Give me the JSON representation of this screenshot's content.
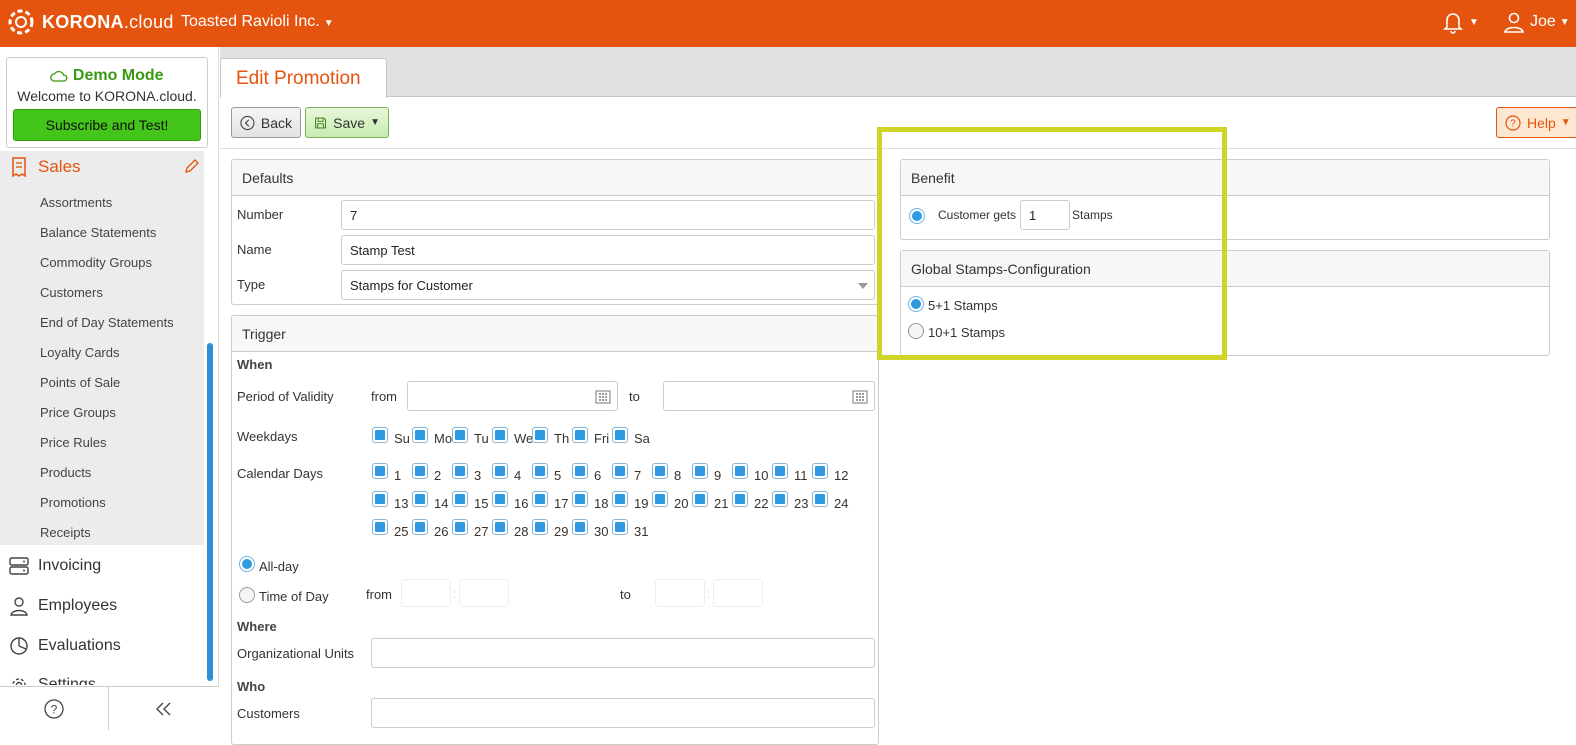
{
  "topbar": {
    "logo_text": "KORONA",
    "logo_suffix": ".cloud",
    "company": "Toasted Ravioli Inc.",
    "user": "Joe"
  },
  "sidebar": {
    "demo_title": "Demo Mode",
    "demo_welcome": "Welcome to KORONA.cloud.",
    "subscribe_label": "Subscribe and Test!",
    "sales_label": "Sales",
    "sales_items": [
      "Assortments",
      "Balance Statements",
      "Commodity Groups",
      "Customers",
      "End of Day Statements",
      "Loyalty Cards",
      "Points of Sale",
      "Price Groups",
      "Price Rules",
      "Products",
      "Promotions",
      "Receipts"
    ],
    "main_items": [
      "Invoicing",
      "Employees",
      "Evaluations",
      "Settings"
    ]
  },
  "tab": {
    "label": "Edit Promotion"
  },
  "toolbar": {
    "back_label": "Back",
    "save_label": "Save",
    "help_label": "Help"
  },
  "defaults": {
    "title": "Defaults",
    "number_label": "Number",
    "number_value": "7",
    "name_label": "Name",
    "name_value": "Stamp Test",
    "type_label": "Type",
    "type_value": "Stamps for Customer"
  },
  "trigger": {
    "title": "Trigger",
    "when_label": "When",
    "period_label": "Period of Validity",
    "from_label": "from",
    "to_label": "to",
    "weekdays_label": "Weekdays",
    "weekdays": [
      "Su",
      "Mo",
      "Tu",
      "We",
      "Th",
      "Fri",
      "Sa"
    ],
    "calendar_label": "Calendar Days",
    "days": [
      "1",
      "2",
      "3",
      "4",
      "5",
      "6",
      "7",
      "8",
      "9",
      "10",
      "11",
      "12",
      "13",
      "14",
      "15",
      "16",
      "17",
      "18",
      "19",
      "20",
      "21",
      "22",
      "23",
      "24",
      "25",
      "26",
      "27",
      "28",
      "29",
      "30",
      "31"
    ],
    "allday_label": "All-day",
    "timeofday_label": "Time of Day",
    "time_from_label": "from",
    "time_to_label": "to",
    "time_separator": ":",
    "where_label": "Where",
    "org_units_label": "Organizational Units",
    "who_label": "Who",
    "customers_label": "Customers"
  },
  "benefit": {
    "title": "Benefit",
    "prefix": "Customer gets",
    "stamps_value": "1",
    "suffix": "Stamps"
  },
  "global_stamps": {
    "title": "Global Stamps-Configuration",
    "option1": "5+1 Stamps",
    "option2": "10+1 Stamps"
  },
  "colors": {
    "brand": "#e5540f",
    "highlight": "#cfd526",
    "check": "#2f9ae0"
  }
}
